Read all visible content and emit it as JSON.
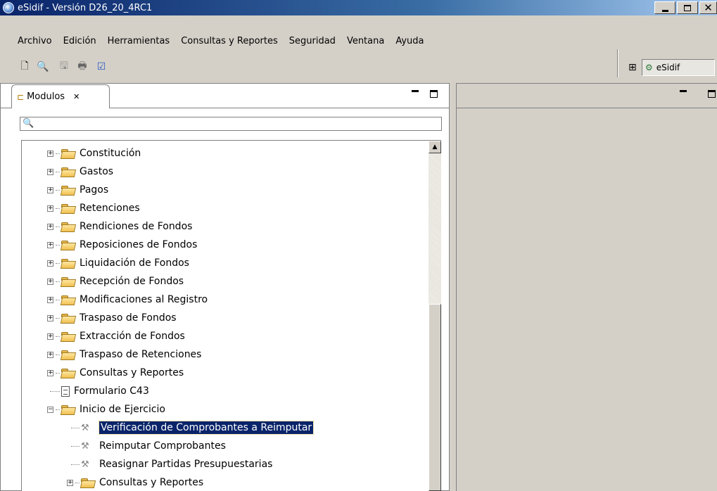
{
  "window": {
    "title": "eSidif - Versión D26_20_4RC1"
  },
  "menu": [
    "Archivo",
    "Edición",
    "Herramientas",
    "Consultas y Reportes",
    "Seguridad",
    "Ventana",
    "Ayuda"
  ],
  "toolbar": {
    "perspective_label": "eSidif"
  },
  "modules_view": {
    "tab_label": "Modulos",
    "filter_value": "",
    "tree": [
      {
        "label": "Constitución",
        "kind": "folder",
        "level": 0,
        "expanded": false
      },
      {
        "label": "Gastos",
        "kind": "folder",
        "level": 0,
        "expanded": false
      },
      {
        "label": "Pagos",
        "kind": "folder",
        "level": 0,
        "expanded": false
      },
      {
        "label": "Retenciones",
        "kind": "folder",
        "level": 0,
        "expanded": false
      },
      {
        "label": "Rendiciones de Fondos",
        "kind": "folder",
        "level": 0,
        "expanded": false
      },
      {
        "label": "Reposiciones de Fondos",
        "kind": "folder",
        "level": 0,
        "expanded": false
      },
      {
        "label": "Liquidación de Fondos",
        "kind": "folder",
        "level": 0,
        "expanded": false
      },
      {
        "label": "Recepción de Fondos",
        "kind": "folder",
        "level": 0,
        "expanded": false
      },
      {
        "label": "Modificaciones al Registro",
        "kind": "folder",
        "level": 0,
        "expanded": false
      },
      {
        "label": "Traspaso de Fondos",
        "kind": "folder",
        "level": 0,
        "expanded": false
      },
      {
        "label": "Extracción de Fondos",
        "kind": "folder",
        "level": 0,
        "expanded": false
      },
      {
        "label": "Traspaso de Retenciones",
        "kind": "folder",
        "level": 0,
        "expanded": false
      },
      {
        "label": "Consultas y Reportes",
        "kind": "folder",
        "level": 0,
        "expanded": false
      },
      {
        "label": "Formulario C43",
        "kind": "document",
        "level": 0
      },
      {
        "label": "Inicio de Ejercicio",
        "kind": "folder",
        "level": 0,
        "expanded": true
      },
      {
        "label": "Verificación de Comprobantes a Reimputar",
        "kind": "tool",
        "level": 1,
        "selected": true
      },
      {
        "label": "Reimputar Comprobantes",
        "kind": "tool",
        "level": 1
      },
      {
        "label": "Reasignar Partidas Presupuestarias",
        "kind": "tool",
        "level": 1
      },
      {
        "label": "Consultas y Reportes",
        "kind": "folder",
        "level": 1,
        "expanded": false
      }
    ]
  }
}
